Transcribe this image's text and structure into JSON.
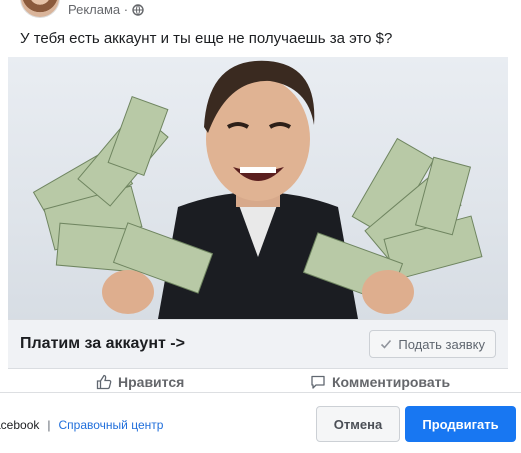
{
  "post": {
    "sponsored_label": "Реклама · ",
    "text": "У тебя есть аккаунт и ты еще не получаешь за это $?",
    "cta_title": "Платим за аккаунт ->",
    "apply_button": "Подать заявку"
  },
  "actions": {
    "like": "Нравится",
    "comment": "Комментировать"
  },
  "footer": {
    "facebook_link": "acebook",
    "separator": "|",
    "help_link": "Справочный центр",
    "cancel_button": "Отмена",
    "promote_button": "Продвигать"
  },
  "icons": {
    "globe": "globe-icon",
    "check": "check-icon",
    "like": "thumbs-up-icon",
    "comment": "comment-icon"
  },
  "colors": {
    "accent": "#1877f2",
    "link": "#216fdb",
    "cta_bar_bg": "#f0f2f5"
  }
}
